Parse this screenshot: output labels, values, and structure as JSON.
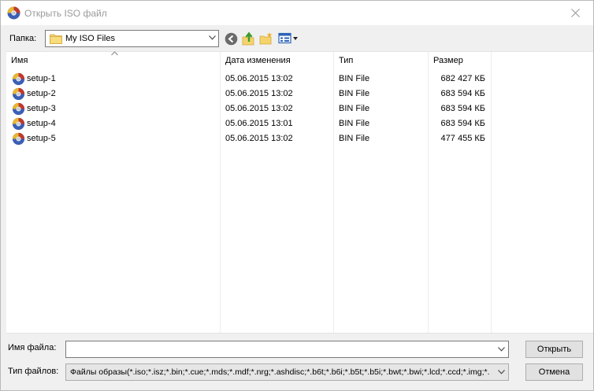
{
  "window": {
    "title": "Открыть ISO файл"
  },
  "toolbar": {
    "folder_label": "Папка:",
    "folder_value": "My ISO Files",
    "icons": [
      "back-icon",
      "up-folder-icon",
      "new-folder-icon",
      "view-menu-icon"
    ]
  },
  "columns": [
    {
      "label": "Имя"
    },
    {
      "label": "Дата изменения"
    },
    {
      "label": "Тип"
    },
    {
      "label": "Размер"
    }
  ],
  "files": [
    {
      "name": "setup-1",
      "date": "05.06.2015 13:02",
      "type": "BIN File",
      "size": "682 427 КБ"
    },
    {
      "name": "setup-2",
      "date": "05.06.2015 13:02",
      "type": "BIN File",
      "size": "683 594 КБ"
    },
    {
      "name": "setup-3",
      "date": "05.06.2015 13:02",
      "type": "BIN File",
      "size": "683 594 КБ"
    },
    {
      "name": "setup-4",
      "date": "05.06.2015 13:01",
      "type": "BIN File",
      "size": "683 594 КБ"
    },
    {
      "name": "setup-5",
      "date": "05.06.2015 13:02",
      "type": "BIN File",
      "size": "477 455 КБ"
    }
  ],
  "bottom": {
    "filename_label": "Имя файла:",
    "filename_value": "",
    "filetype_label": "Тип файлов:",
    "filetype_value": "Файлы образы(*.iso;*.isz;*.bin;*.cue;*.mds;*.mdf;*.nrg;*.ashdisc;*.b6t;*.b6i;*.b5t;*.b5i;*.bwt;*.bwi;*.lcd;*.ccd;*.img;*.",
    "open_label": "Открыть",
    "cancel_label": "Отмена"
  },
  "colors": {
    "title_text": "#9a9a9a",
    "folder_yellow": "#f5d36b",
    "arrow_green": "#3a9c2d",
    "disc_blue": "#3c5fb5",
    "disc_red": "#c0392b"
  }
}
